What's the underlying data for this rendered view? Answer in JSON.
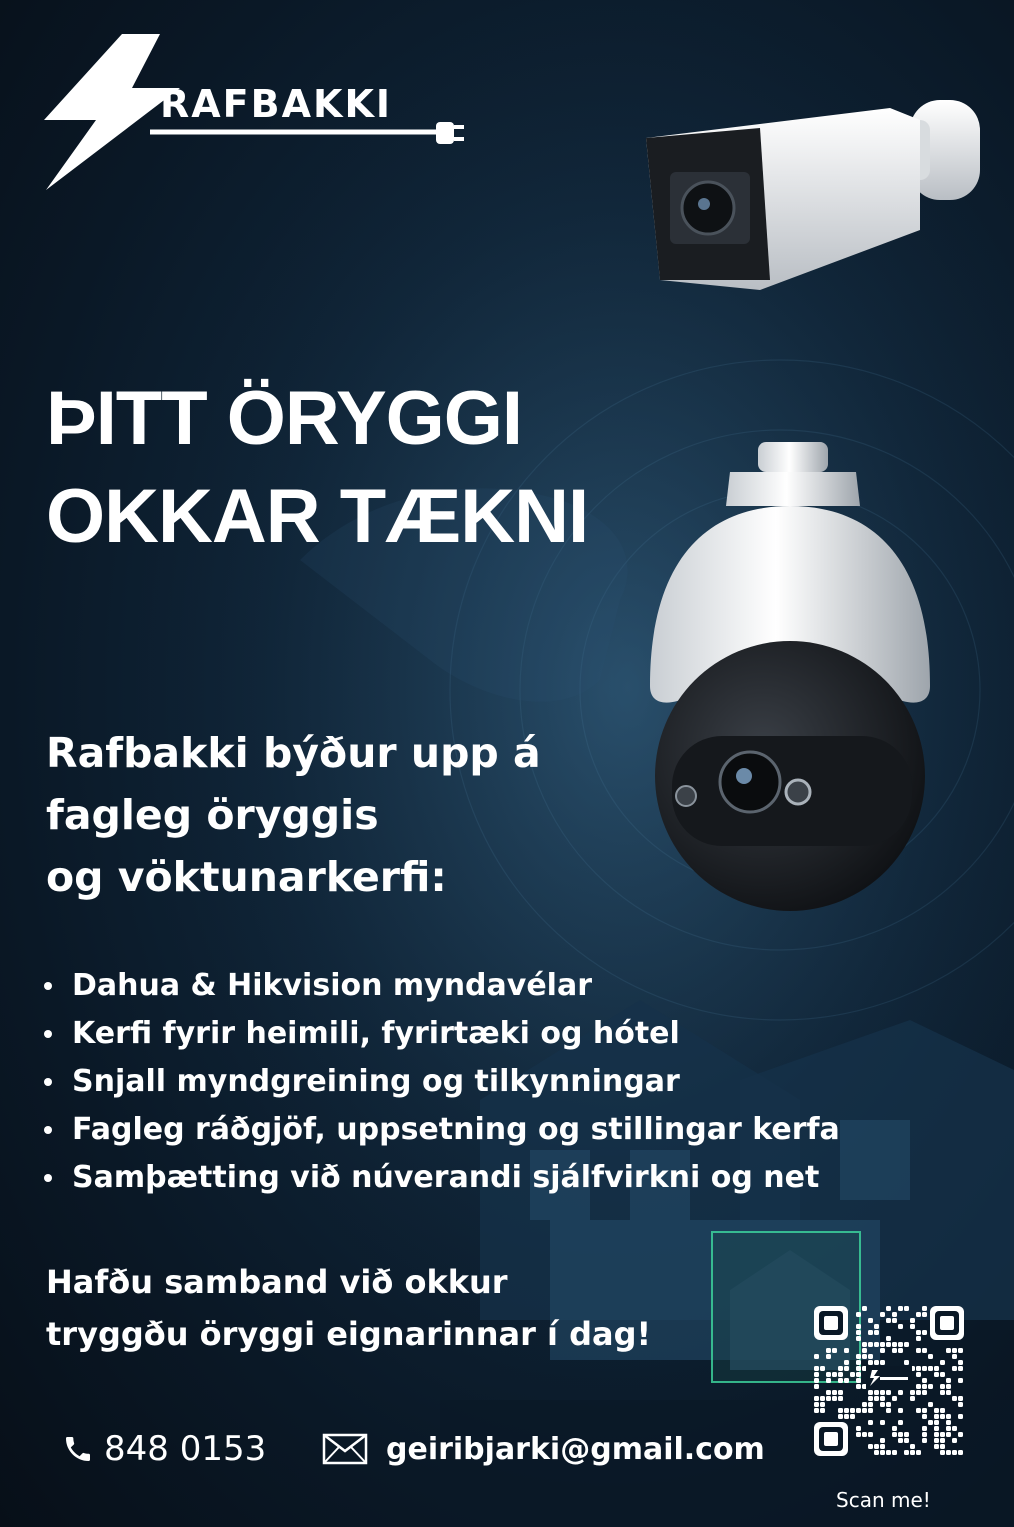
{
  "brand": {
    "name": "RAFBAKKI"
  },
  "headline": {
    "line1": "ÞITT ÖRYGGI",
    "line2": "OKKAR TÆKNI"
  },
  "intro": {
    "line1": "Rafbakki býður upp á",
    "line2": "fagleg öryggis",
    "line3": "og vöktunarkerfi:"
  },
  "services": [
    "Dahua & Hikvision myndavélar",
    "Kerfi fyrir heimili, fyrirtæki og hótel",
    "Snjall myndgreining og tilkynningar",
    "Fagleg ráðgjöf, uppsetning og stillingar kerfa",
    "Samþætting við núverandi sjálfvirkni og net"
  ],
  "cta": {
    "line1": "Hafðu samband við okkur",
    "line2": "tryggðu öryggi eignarinnar í dag!"
  },
  "contact": {
    "phone": "848 0153",
    "email": "geiribjarki@gmail.com",
    "phone_icon": "phone-icon",
    "email_icon": "envelope-icon"
  },
  "qr": {
    "caption": "Scan me!"
  },
  "colors": {
    "background": "#0a1826",
    "accent_glow": "#1c3a52",
    "text": "#ffffff",
    "highlight_green": "#3fd9a0"
  }
}
